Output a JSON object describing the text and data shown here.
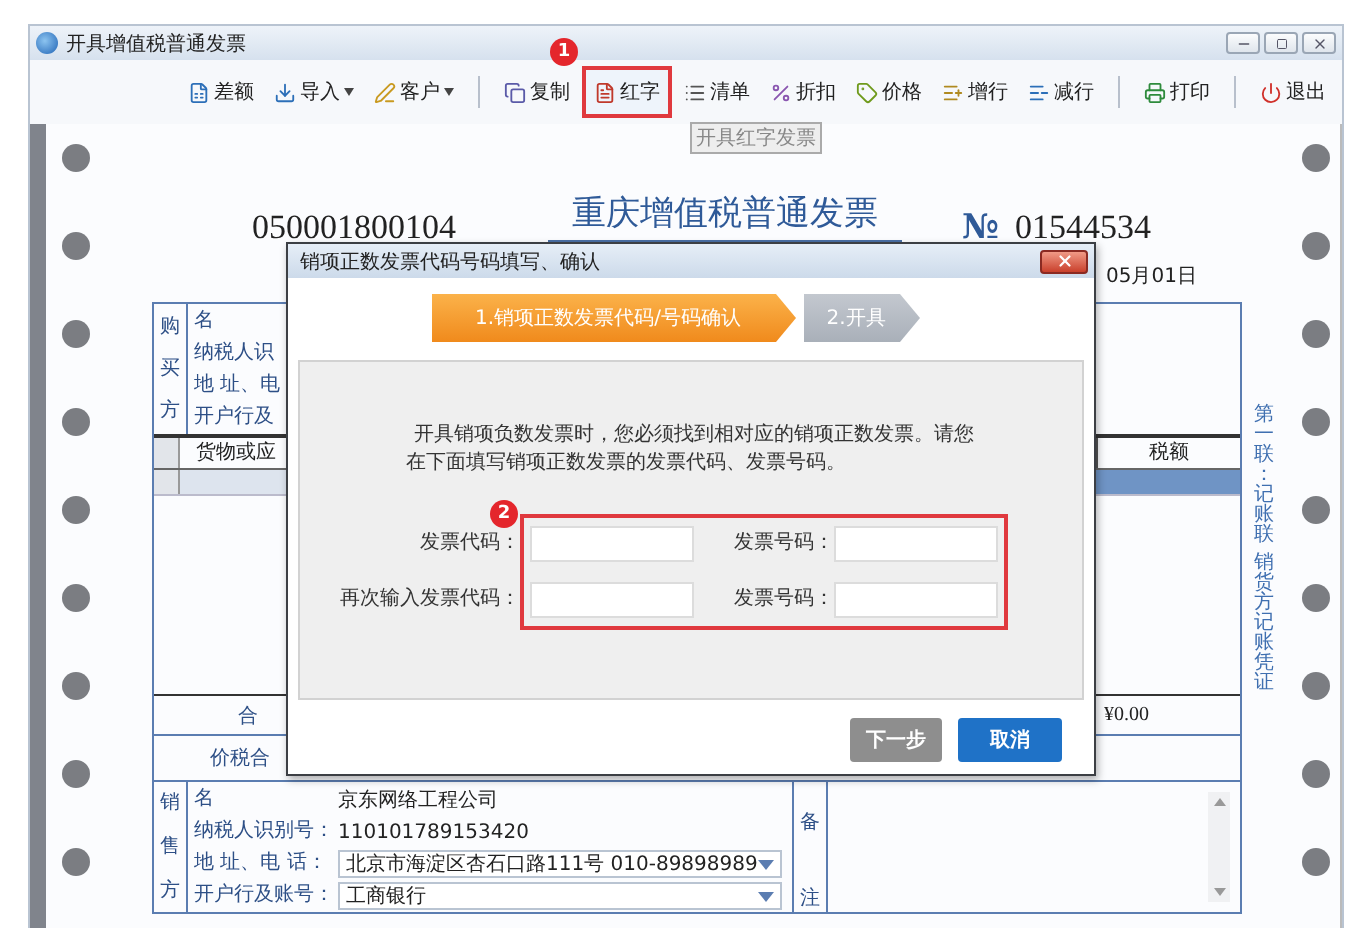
{
  "window": {
    "title": "开具增值税普通发票"
  },
  "toolbar": {
    "items": [
      {
        "label": "差额",
        "kind": "button"
      },
      {
        "label": "导入",
        "kind": "dropdown"
      },
      {
        "label": "客户",
        "kind": "dropdown"
      },
      {
        "kind": "separator"
      },
      {
        "label": "复制",
        "kind": "button"
      },
      {
        "label": "红字",
        "kind": "button",
        "callout": "1"
      },
      {
        "label": "清单",
        "kind": "button"
      },
      {
        "label": "折扣",
        "kind": "button"
      },
      {
        "label": "价格",
        "kind": "button"
      },
      {
        "label": "增行",
        "kind": "button"
      },
      {
        "label": "减行",
        "kind": "button"
      },
      {
        "kind": "separator"
      },
      {
        "label": "打印",
        "kind": "button"
      },
      {
        "kind": "separator"
      },
      {
        "label": "退出",
        "kind": "button"
      }
    ]
  },
  "tooltip": "开具红字发票",
  "invoice": {
    "code": "050001800104",
    "title": "重庆增值税普通发票",
    "number_sign": "№",
    "number": "01544534",
    "date": "05月01日",
    "buyer": {
      "side_label": "购买方",
      "rows": [
        "名",
        "纳税人识",
        "地 址、电",
        "开户行及"
      ]
    },
    "goods": {
      "columns": [
        "货物或应",
        "税额"
      ]
    },
    "total_label": "合",
    "total_amount": "¥0.00",
    "grand_total_label": "价税合",
    "seller": {
      "side_label": "销售方",
      "rows": [
        {
          "label": "名",
          "value": "京东网络工程公司",
          "kind": "text"
        },
        {
          "label": "纳税人识别号：",
          "value": "110101789153420",
          "kind": "text"
        },
        {
          "label": "地 址、电 话：",
          "value": "北京市海淀区杏石口路111号 010-89898989",
          "kind": "dropdown"
        },
        {
          "label": "开户行及账号：",
          "value": "工商银行",
          "kind": "dropdown"
        }
      ]
    },
    "remarks_label": "备注",
    "copy_label": [
      "第一联：记账联",
      "销货方记账凭证"
    ]
  },
  "dialog": {
    "title": "销项正数发票代码号码填写、确认",
    "steps": [
      {
        "label": "1.销项正数发票代码/号码确认",
        "selected": true
      },
      {
        "label": "2.开具",
        "selected": false
      }
    ],
    "message": "开具销项负数发票时，您必须找到相对应的销项正数发票。请您在下面填写销项正数发票的发票代码、发票号码。",
    "callout": "2",
    "fields": [
      [
        {
          "label": "发票代码："
        },
        {
          "label": "发票号码："
        }
      ],
      [
        {
          "label": "再次输入发票代码："
        },
        {
          "label": "发票号码："
        }
      ]
    ],
    "buttons": [
      {
        "label": "下一步",
        "disabled": true
      },
      {
        "label": "取消",
        "disabled": false
      }
    ]
  }
}
